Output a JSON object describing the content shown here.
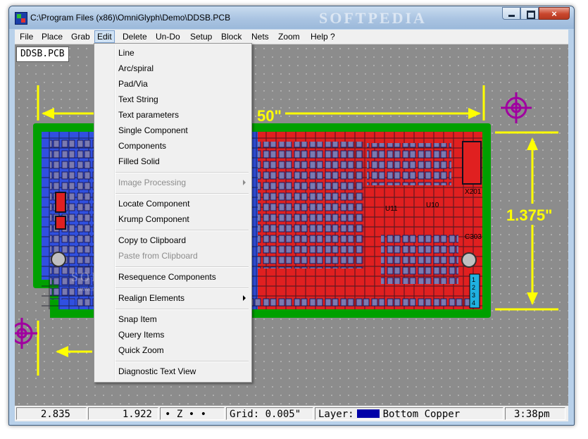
{
  "window": {
    "title": "C:\\Program Files (x86)\\OmniGlyph\\Demo\\DDSB.PCB",
    "close_glyph": "×",
    "watermark_title": "SOFTPEDIA"
  },
  "menubar": {
    "items": [
      "File",
      "Place",
      "Grab",
      "Edit",
      "Delete",
      "Un-Do",
      "Setup",
      "Block",
      "Nets",
      "Zoom",
      "Help ?"
    ],
    "active": "Edit"
  },
  "document": {
    "tab_label": "DDSB.PCB",
    "dimension_left": "50\"",
    "dimension_right": "1.375\"",
    "watermark": "SOFTPEDIA",
    "watermark_sub": "www.softpedia.com"
  },
  "board_labels": {
    "x201": "X201",
    "c303": "C303",
    "u11": "U11",
    "u10": "U10",
    "r_mark": "R",
    "layer_marks": [
      "1",
      "2",
      "3",
      "4"
    ]
  },
  "edit_menu": {
    "items": [
      {
        "label": "Line",
        "enabled": true,
        "submenu": false
      },
      {
        "label": "Arc/spiral",
        "enabled": true,
        "submenu": false
      },
      {
        "label": "Pad/Via",
        "enabled": true,
        "submenu": false
      },
      {
        "label": "Text String",
        "enabled": true,
        "submenu": false
      },
      {
        "label": "Text parameters",
        "enabled": true,
        "submenu": false
      },
      {
        "label": "Single Component",
        "enabled": true,
        "submenu": false
      },
      {
        "label": "Components",
        "enabled": true,
        "submenu": false
      },
      {
        "label": "Filled Solid",
        "enabled": true,
        "submenu": false
      },
      {
        "label": "Image Processing",
        "enabled": false,
        "submenu": true
      },
      {
        "label": "Locate Component",
        "enabled": true,
        "submenu": false
      },
      {
        "label": "Krump Component",
        "enabled": true,
        "submenu": false
      },
      {
        "label": "Copy to Clipboard",
        "enabled": true,
        "submenu": false
      },
      {
        "label": "Paste from Clipboard",
        "enabled": false,
        "submenu": false
      },
      {
        "label": "Resequence Components",
        "enabled": true,
        "submenu": false
      },
      {
        "label": "Realign Elements",
        "enabled": true,
        "submenu": true
      },
      {
        "label": "Snap Item",
        "enabled": true,
        "submenu": false
      },
      {
        "label": "Query Items",
        "enabled": true,
        "submenu": false
      },
      {
        "label": "Quick Zoom",
        "enabled": true,
        "submenu": false
      },
      {
        "label": "Diagnostic Text View",
        "enabled": true,
        "submenu": false
      }
    ]
  },
  "statusbar": {
    "x": "2.835",
    "y": "1.922",
    "indicators": "• Z • •",
    "grid": "Grid: 0.005\"",
    "layer_label": "Layer:",
    "layer_name": "Bottom Copper",
    "layer_color": "#0000a8",
    "time": "3:38pm"
  },
  "colors": {
    "board_outline": "#00a000",
    "top_copper": "#e02020",
    "bottom_copper": "#3050e0",
    "dimension": "#ffff00",
    "target_mark": "#a000a0",
    "pad": "#7a7ab0"
  }
}
